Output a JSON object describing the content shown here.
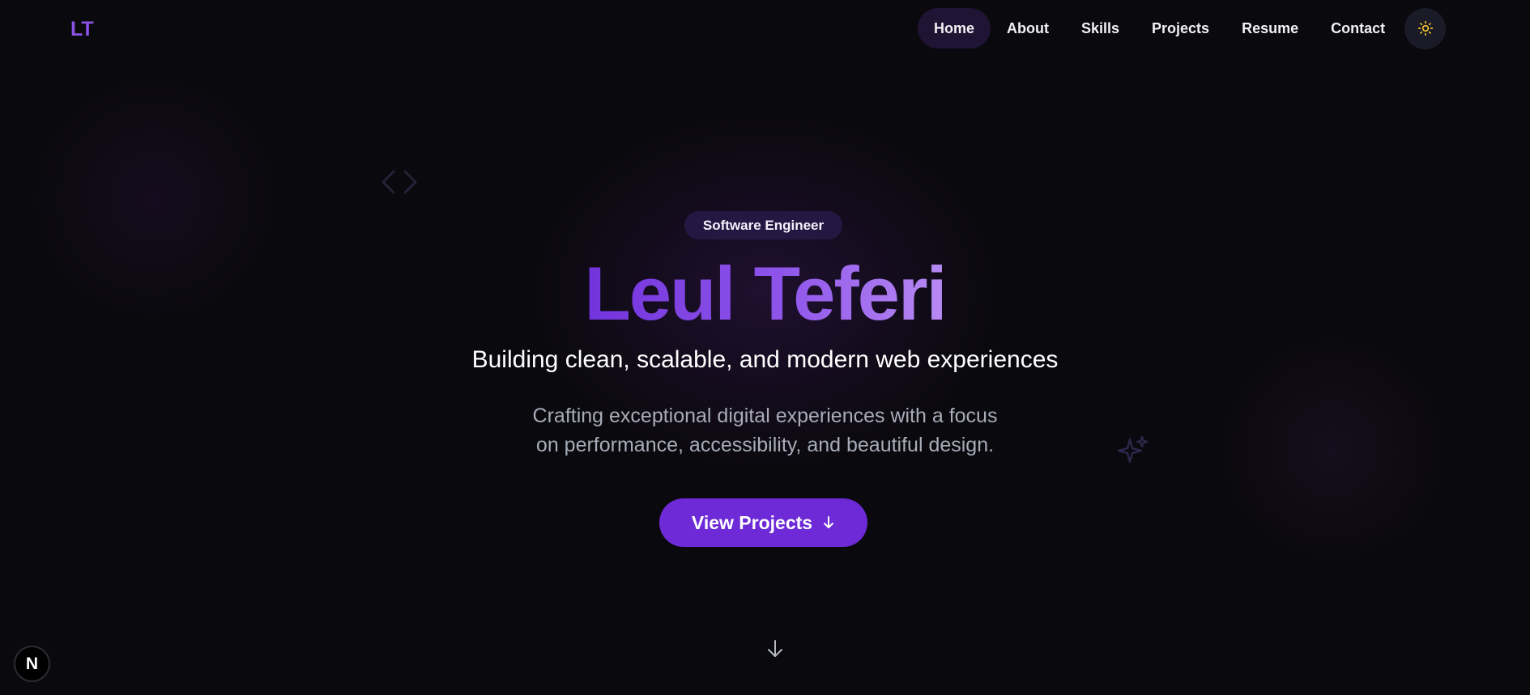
{
  "header": {
    "logo": "LT",
    "nav": [
      {
        "label": "Home",
        "active": true
      },
      {
        "label": "About"
      },
      {
        "label": "Skills"
      },
      {
        "label": "Projects"
      },
      {
        "label": "Resume"
      },
      {
        "label": "Contact"
      }
    ],
    "theme_toggle_icon": "sun-icon"
  },
  "hero": {
    "badge": "Software Engineer",
    "name": "Leul Teferi",
    "tagline": "Building clean, scalable, and modern web experiences",
    "description_line1": "Crafting exceptional digital experiences with a focus",
    "description_line2": "on performance, accessibility, and beautiful design.",
    "cta_label": "View Projects",
    "cta_icon": "arrow-down-icon",
    "scroll_icon": "arrow-down-icon"
  },
  "decorations": {
    "code_icon": "code-brackets-icon",
    "sparkle_icon": "sparkles-icon"
  },
  "dev_badge": {
    "letter": "N",
    "icon": "nextjs-icon"
  },
  "colors": {
    "background": "#0a090d",
    "accent": "#6d2ad6",
    "logo": "#8b52e6",
    "badge_bg": "#241842",
    "nav_active_bg": "#1f1433",
    "sun": "#f2c230",
    "muted_text": "#a7acb8"
  }
}
